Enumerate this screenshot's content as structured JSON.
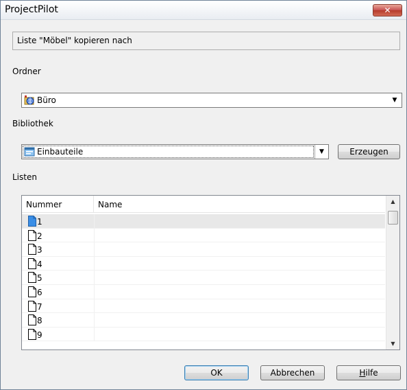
{
  "window": {
    "title": "ProjectPilot",
    "close_glyph": "✕"
  },
  "header": {
    "info_text": "Liste \"Möbel\" kopieren nach"
  },
  "folder": {
    "label": "Ordner",
    "value": "Büro",
    "icon": "folder-globe-icon"
  },
  "library": {
    "label": "Bibliothek",
    "value": "Einbauteile",
    "icon": "library-icon",
    "create_button": "Erzeugen"
  },
  "lists": {
    "label": "Listen",
    "columns": [
      "Nummer",
      "Name"
    ],
    "rows": [
      {
        "nummer": "1",
        "name": "",
        "selected": true
      },
      {
        "nummer": "2",
        "name": ""
      },
      {
        "nummer": "3",
        "name": ""
      },
      {
        "nummer": "4",
        "name": ""
      },
      {
        "nummer": "5",
        "name": ""
      },
      {
        "nummer": "6",
        "name": ""
      },
      {
        "nummer": "7",
        "name": ""
      },
      {
        "nummer": "8",
        "name": ""
      },
      {
        "nummer": "9",
        "name": ""
      }
    ]
  },
  "footer": {
    "ok": "OK",
    "cancel": "Abbrechen",
    "help": "Hilfe"
  },
  "colors": {
    "selected_row": "#e8e8e8",
    "doc_selected": "#3a8ee6"
  }
}
